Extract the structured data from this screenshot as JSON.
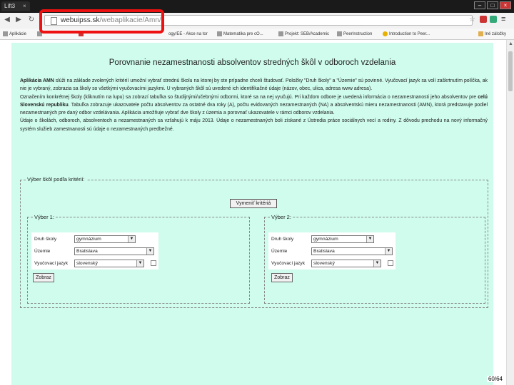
{
  "browser": {
    "tab_title": "Lift3",
    "address_host": "webuipss.sk",
    "address_path": "/webaplikacie/Amn/",
    "bookmarks": [
      "Aplikácie",
      "",
      "",
      "ogy/EE - Akce na tor",
      "Matematika pre cO...",
      "Projekt: SEB/Academic",
      "PeerInstruction",
      "Introduction to Peer...",
      "Iné záložky"
    ]
  },
  "page": {
    "title": "Porovnanie nezamestnanosti absolventov stredných škôl v odboroch vzdelania",
    "paragraphs": [
      {
        "bold_start": "Aplikácia AMN",
        "text": " slúži na základe zvolených kritérií umožní vybrať strednú školu na ktorej by ste prípadne chceli študovať. Položky \"Druh školy\" a \"Územie\" sú povinné. Vyučovací jazyk sa volí zaškrtnutím políčka, ak nie je vybraný, zobrazia sa školy so všetkými vyučovacími jazykmi. U vybraných škôl sú uvedené ich identifikačné údaje (názov, obec, ulica, adresa www adresa)."
      },
      {
        "text_before": "Označením konkrétnej školy (kliknutím na lupu) sa zobrazí tabuľka so študijnými/učebnými odbormi, ktoré sa na nej vyučujú. Pri každom odbore je uvedená informácia o nezamestnanosti jeho absolventov pre ",
        "bold": "celú Slovenskú republiku",
        "text_after": ". Tabuľka zobrazuje ukazovatele počtu absolventov za ostatné dva roky (A), počtu evidovaných nezamestnaných (NA) a absolventskú mieru nezamestnanosti (AMN), ktorá predstavuje podiel nezamestnaných pre daný odbor vzdelávania. Aplikácia umožňuje vybrať dve školy z územia a porovnať ukazovatele v rámci odborov vzdelania."
      },
      {
        "text": "Údaje o školách, odboroch, absolventoch a nezamestnaných sa vzťahujú k máju 2013. Údaje o nezamestnaných boli získané z Ústredia práce sociálnych vecí a rodiny. Z dôvodu prechodu na nový informačný systém služieb zamestnanosti sú údaje o nezamestnaných predbežné."
      }
    ],
    "criteria_legend": "Výber škôl podľa kritérií:",
    "swap_button": "Vymeniť kritériá",
    "selections": [
      {
        "legend": "Výber 1:",
        "labels": [
          "Druh školy",
          "Územie",
          "Vyučovací jazyk"
        ],
        "values": [
          "gymnázium",
          "Bratislava",
          "slovenský"
        ],
        "submit": "Zobraz"
      },
      {
        "legend": "Výber 2:",
        "labels": [
          "Druh školy",
          "Územie",
          "Vyučovací jazyk"
        ],
        "values": [
          "gymnázium",
          "Bratislava",
          "slovenský"
        ],
        "submit": "Zobraz"
      }
    ]
  },
  "slide_number": "60/64",
  "colors": {
    "page_bg": "#cffced",
    "highlight": "#ee1111"
  }
}
